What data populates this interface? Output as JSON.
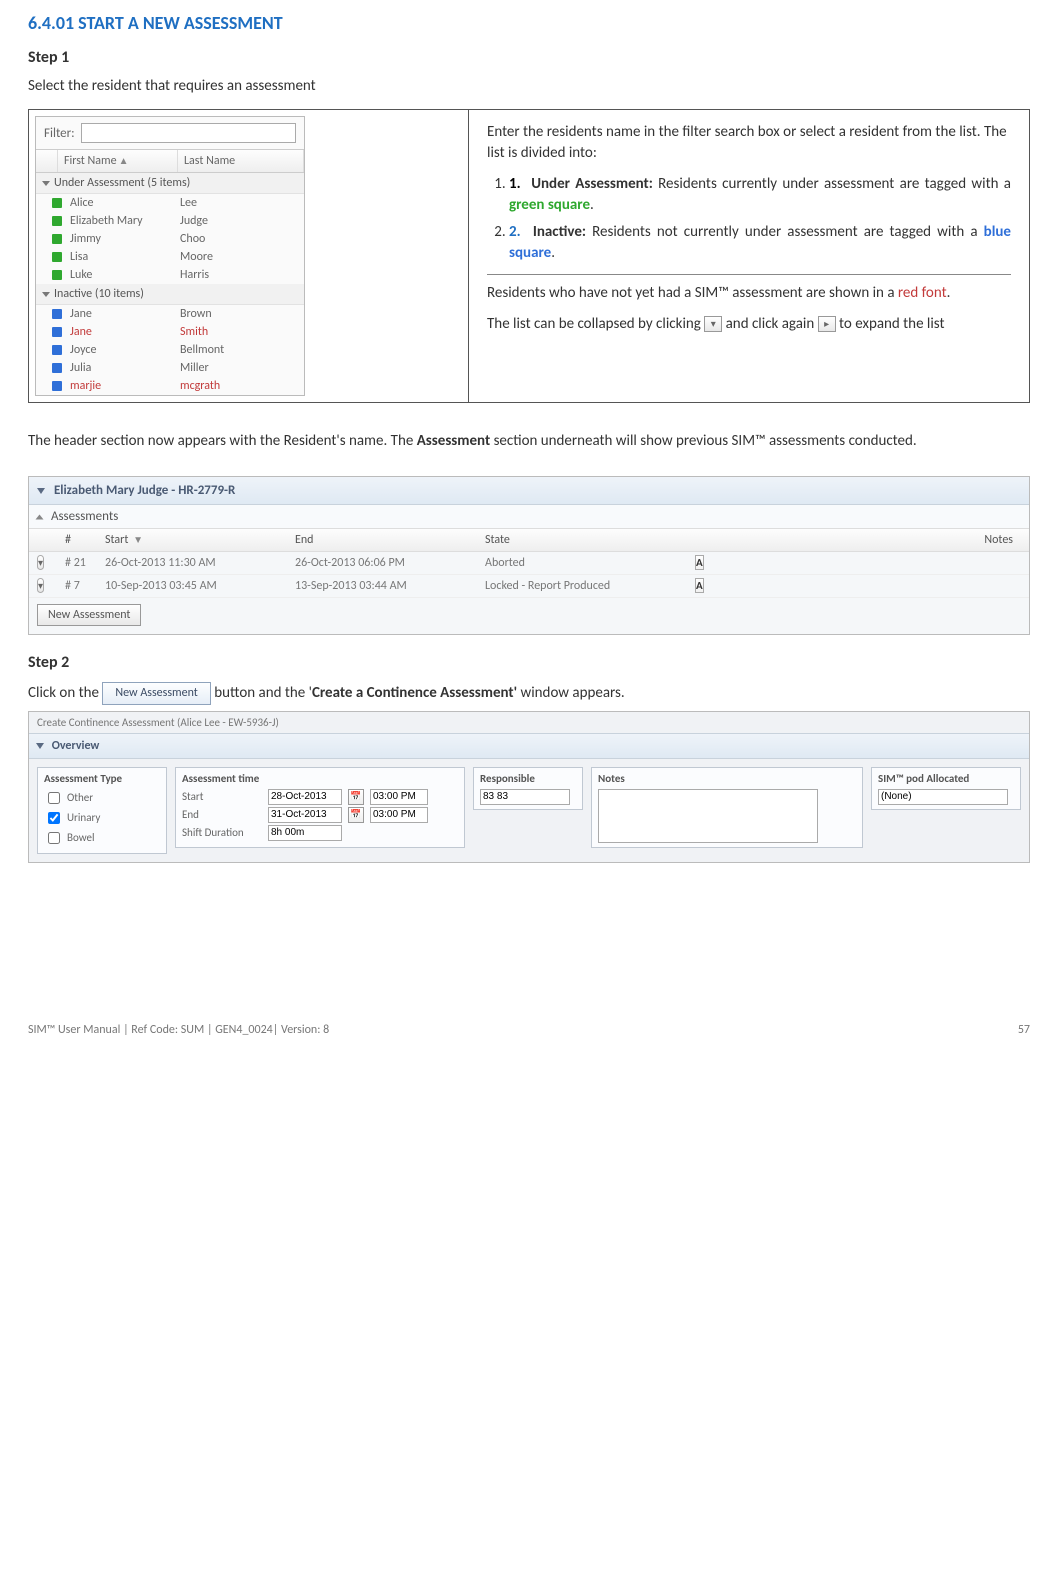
{
  "section_title": "6.4.01 START A NEW ASSESSMENT",
  "step1": {
    "title": "Step 1",
    "desc": "Select the resident that requires an assessment"
  },
  "resident_panel": {
    "filter_label": "Filter:",
    "filter_value": "",
    "columns": {
      "first": "First Name",
      "last": "Last Name"
    },
    "groups": [
      {
        "title": "Under Assessment (5 items)",
        "color": "green",
        "rows": [
          {
            "first": "Alice",
            "last": "Lee",
            "red": false
          },
          {
            "first": "Elizabeth Mary",
            "last": "Judge",
            "red": false
          },
          {
            "first": "Jimmy",
            "last": "Choo",
            "red": false
          },
          {
            "first": "Lisa",
            "last": "Moore",
            "red": false
          },
          {
            "first": "Luke",
            "last": "Harris",
            "red": false
          }
        ]
      },
      {
        "title": "Inactive (10 items)",
        "color": "blue",
        "rows": [
          {
            "first": "Jane",
            "last": "Brown",
            "red": false
          },
          {
            "first": "Jane",
            "last": "Smith",
            "red": true
          },
          {
            "first": "Joyce",
            "last": "Bellmont",
            "red": false
          },
          {
            "first": "Julia",
            "last": "Miller",
            "red": false
          },
          {
            "first": "marjie",
            "last": "mcgrath",
            "red": true
          }
        ]
      }
    ]
  },
  "right_box": {
    "intro": "Enter the residents name in the filter search box or select a resident from the list. The list is divided into:",
    "item1_bold": "Under Assessment:",
    "item1_rest": " Residents currently under assessment are tagged with a ",
    "item1_color": "green square",
    "item2_bold": "Inactive:",
    "item2_rest": " Residents not currently under assessment are tagged with a ",
    "item2_color": "blue square",
    "after_list_a": "Residents who have not yet had a SIM™ assessment are shown in a ",
    "after_list_red": "red font",
    "collapse_a": "The list can be collapsed by clicking ",
    "collapse_b": " and click again ",
    "collapse_c": " to expand the list"
  },
  "mid_para_a": "The header section now appears with the Resident's name. The ",
  "mid_para_bold": "Assessment",
  "mid_para_b": " section underneath will show previous SIM™ assessments conducted.",
  "assessments_panel": {
    "title": "Elizabeth Mary Judge  -  HR-2779-R",
    "sub": "Assessments",
    "headers": {
      "c1": "",
      "c2": "#",
      "c3": "Start",
      "c4": "End",
      "c5": "State",
      "c6": "",
      "c7": "Notes"
    },
    "rows": [
      {
        "num": "# 21",
        "start": "26-Oct-2013 11:30 AM",
        "end": "26-Oct-2013 06:06 PM",
        "state": "Aborted"
      },
      {
        "num": "# 7",
        "start": "10-Sep-2013 03:45 AM",
        "end": "13-Sep-2013 03:44 AM",
        "state": "Locked - Report Produced"
      }
    ],
    "new_btn": "New Assessment"
  },
  "step2": {
    "title": "Step 2",
    "line_a": "Click on the ",
    "btn": "New Assessment",
    "line_b": " button and the '",
    "bold": "Create a Continence Assessment'",
    "line_c": " window appears."
  },
  "overview": {
    "window_title": "Create Continence Assessment (Alice Lee - EW-5936-J)",
    "header": "Overview",
    "type_label": "Assessment Type",
    "types": {
      "other": "Other",
      "urinary": "Urinary",
      "bowel": "Bowel"
    },
    "time_label": "Assessment time",
    "start_label": "Start",
    "end_label": "End",
    "shift_label": "Shift Duration",
    "start_date": "28-Oct-2013",
    "end_date": "31-Oct-2013",
    "start_time": "03:00 PM",
    "end_time": "03:00 PM",
    "shift_value": "8h 00m",
    "resp_label": "Responsible",
    "resp_value": "83 83",
    "notes_label": "Notes",
    "pod_label": "SIM™ pod Allocated",
    "pod_value": "(None)"
  },
  "footer": {
    "left": "SIM™ User Manual | Ref Code: SUM | GEN4_0024| Version: 8",
    "right": "57"
  }
}
